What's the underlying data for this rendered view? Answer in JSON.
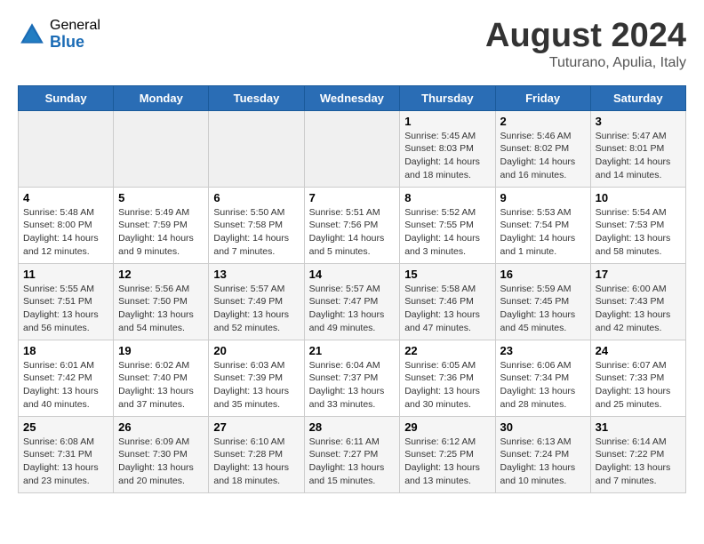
{
  "logo": {
    "general": "General",
    "blue": "Blue"
  },
  "header": {
    "month": "August 2024",
    "location": "Tuturano, Apulia, Italy"
  },
  "weekdays": [
    "Sunday",
    "Monday",
    "Tuesday",
    "Wednesday",
    "Thursday",
    "Friday",
    "Saturday"
  ],
  "weeks": [
    [
      {
        "day": "",
        "info": ""
      },
      {
        "day": "",
        "info": ""
      },
      {
        "day": "",
        "info": ""
      },
      {
        "day": "",
        "info": ""
      },
      {
        "day": "1",
        "info": "Sunrise: 5:45 AM\nSunset: 8:03 PM\nDaylight: 14 hours\nand 18 minutes."
      },
      {
        "day": "2",
        "info": "Sunrise: 5:46 AM\nSunset: 8:02 PM\nDaylight: 14 hours\nand 16 minutes."
      },
      {
        "day": "3",
        "info": "Sunrise: 5:47 AM\nSunset: 8:01 PM\nDaylight: 14 hours\nand 14 minutes."
      }
    ],
    [
      {
        "day": "4",
        "info": "Sunrise: 5:48 AM\nSunset: 8:00 PM\nDaylight: 14 hours\nand 12 minutes."
      },
      {
        "day": "5",
        "info": "Sunrise: 5:49 AM\nSunset: 7:59 PM\nDaylight: 14 hours\nand 9 minutes."
      },
      {
        "day": "6",
        "info": "Sunrise: 5:50 AM\nSunset: 7:58 PM\nDaylight: 14 hours\nand 7 minutes."
      },
      {
        "day": "7",
        "info": "Sunrise: 5:51 AM\nSunset: 7:56 PM\nDaylight: 14 hours\nand 5 minutes."
      },
      {
        "day": "8",
        "info": "Sunrise: 5:52 AM\nSunset: 7:55 PM\nDaylight: 14 hours\nand 3 minutes."
      },
      {
        "day": "9",
        "info": "Sunrise: 5:53 AM\nSunset: 7:54 PM\nDaylight: 14 hours\nand 1 minute."
      },
      {
        "day": "10",
        "info": "Sunrise: 5:54 AM\nSunset: 7:53 PM\nDaylight: 13 hours\nand 58 minutes."
      }
    ],
    [
      {
        "day": "11",
        "info": "Sunrise: 5:55 AM\nSunset: 7:51 PM\nDaylight: 13 hours\nand 56 minutes."
      },
      {
        "day": "12",
        "info": "Sunrise: 5:56 AM\nSunset: 7:50 PM\nDaylight: 13 hours\nand 54 minutes."
      },
      {
        "day": "13",
        "info": "Sunrise: 5:57 AM\nSunset: 7:49 PM\nDaylight: 13 hours\nand 52 minutes."
      },
      {
        "day": "14",
        "info": "Sunrise: 5:57 AM\nSunset: 7:47 PM\nDaylight: 13 hours\nand 49 minutes."
      },
      {
        "day": "15",
        "info": "Sunrise: 5:58 AM\nSunset: 7:46 PM\nDaylight: 13 hours\nand 47 minutes."
      },
      {
        "day": "16",
        "info": "Sunrise: 5:59 AM\nSunset: 7:45 PM\nDaylight: 13 hours\nand 45 minutes."
      },
      {
        "day": "17",
        "info": "Sunrise: 6:00 AM\nSunset: 7:43 PM\nDaylight: 13 hours\nand 42 minutes."
      }
    ],
    [
      {
        "day": "18",
        "info": "Sunrise: 6:01 AM\nSunset: 7:42 PM\nDaylight: 13 hours\nand 40 minutes."
      },
      {
        "day": "19",
        "info": "Sunrise: 6:02 AM\nSunset: 7:40 PM\nDaylight: 13 hours\nand 37 minutes."
      },
      {
        "day": "20",
        "info": "Sunrise: 6:03 AM\nSunset: 7:39 PM\nDaylight: 13 hours\nand 35 minutes."
      },
      {
        "day": "21",
        "info": "Sunrise: 6:04 AM\nSunset: 7:37 PM\nDaylight: 13 hours\nand 33 minutes."
      },
      {
        "day": "22",
        "info": "Sunrise: 6:05 AM\nSunset: 7:36 PM\nDaylight: 13 hours\nand 30 minutes."
      },
      {
        "day": "23",
        "info": "Sunrise: 6:06 AM\nSunset: 7:34 PM\nDaylight: 13 hours\nand 28 minutes."
      },
      {
        "day": "24",
        "info": "Sunrise: 6:07 AM\nSunset: 7:33 PM\nDaylight: 13 hours\nand 25 minutes."
      }
    ],
    [
      {
        "day": "25",
        "info": "Sunrise: 6:08 AM\nSunset: 7:31 PM\nDaylight: 13 hours\nand 23 minutes."
      },
      {
        "day": "26",
        "info": "Sunrise: 6:09 AM\nSunset: 7:30 PM\nDaylight: 13 hours\nand 20 minutes."
      },
      {
        "day": "27",
        "info": "Sunrise: 6:10 AM\nSunset: 7:28 PM\nDaylight: 13 hours\nand 18 minutes."
      },
      {
        "day": "28",
        "info": "Sunrise: 6:11 AM\nSunset: 7:27 PM\nDaylight: 13 hours\nand 15 minutes."
      },
      {
        "day": "29",
        "info": "Sunrise: 6:12 AM\nSunset: 7:25 PM\nDaylight: 13 hours\nand 13 minutes."
      },
      {
        "day": "30",
        "info": "Sunrise: 6:13 AM\nSunset: 7:24 PM\nDaylight: 13 hours\nand 10 minutes."
      },
      {
        "day": "31",
        "info": "Sunrise: 6:14 AM\nSunset: 7:22 PM\nDaylight: 13 hours\nand 7 minutes."
      }
    ]
  ]
}
